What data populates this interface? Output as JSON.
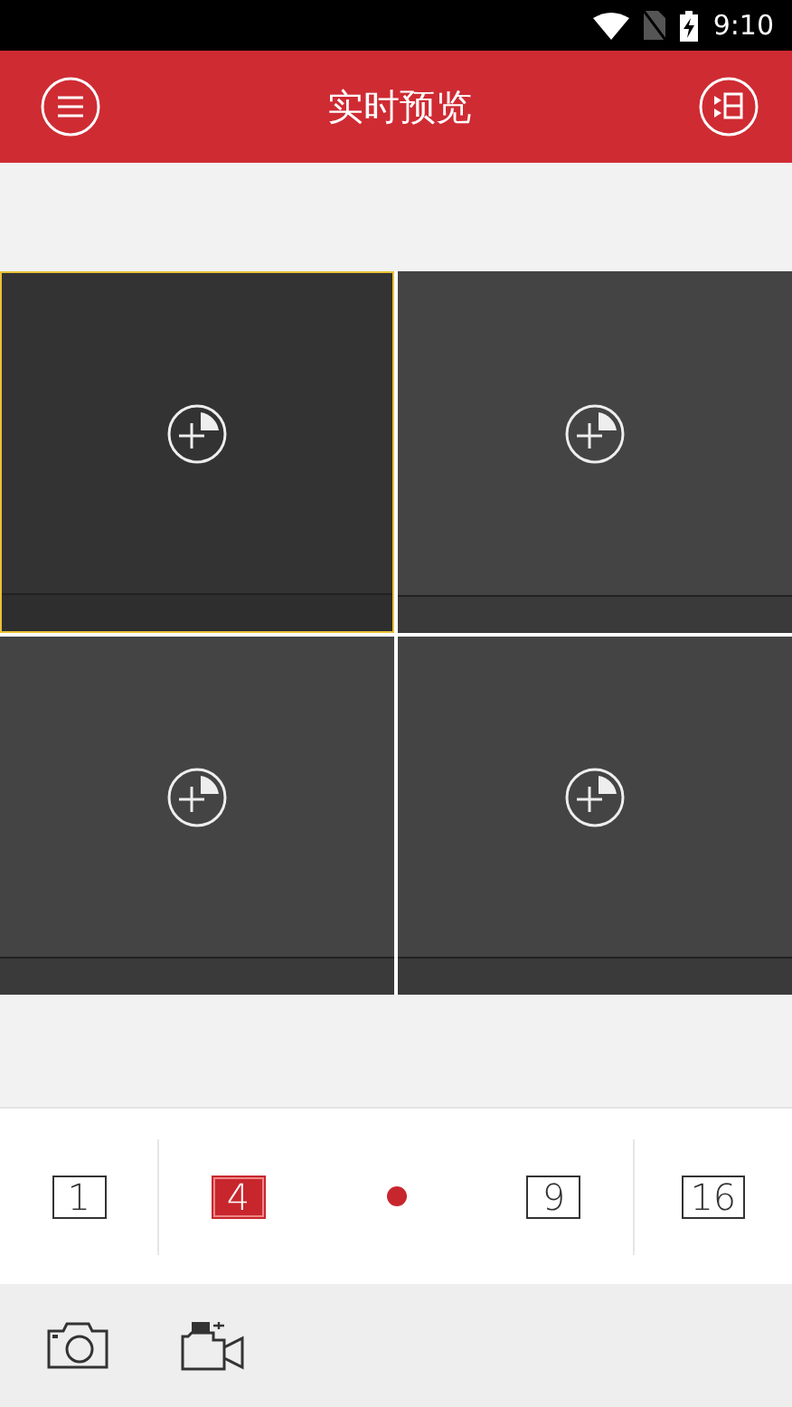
{
  "status_bar": {
    "time": "9:10"
  },
  "header": {
    "title": "实时预览"
  },
  "tiles": [
    {
      "selected": true
    },
    {
      "selected": false
    },
    {
      "selected": false
    },
    {
      "selected": false
    }
  ],
  "layouts": [
    {
      "kind": "layout",
      "label": "1",
      "selected": false
    },
    {
      "kind": "layout",
      "label": "4",
      "selected": true
    },
    {
      "kind": "dot"
    },
    {
      "kind": "layout",
      "label": "9",
      "selected": false
    },
    {
      "kind": "layout",
      "label": "16",
      "selected": false
    }
  ]
}
